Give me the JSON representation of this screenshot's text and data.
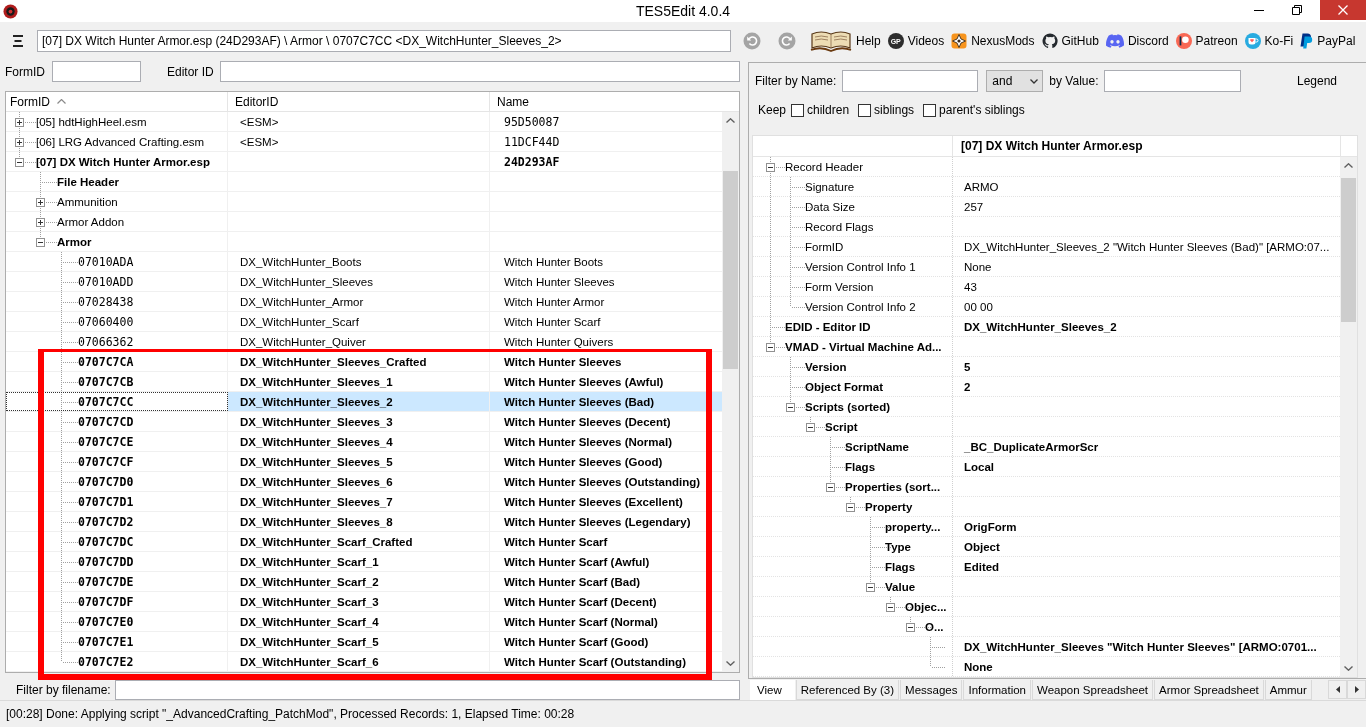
{
  "window": {
    "title": "TES5Edit 4.0.4"
  },
  "toolbar": {
    "path": "[07] DX Witch Hunter Armor.esp (24D293AF) \\ Armor \\ 0707C7CC <DX_WitchHunter_Sleeves_2>",
    "links": [
      {
        "kind": "book",
        "label": "Help"
      },
      {
        "kind": "badge",
        "badge": "GP",
        "label": "Videos"
      },
      {
        "kind": "nexus",
        "label": "NexusMods"
      },
      {
        "kind": "github",
        "label": "GitHub"
      },
      {
        "kind": "discord",
        "label": "Discord"
      },
      {
        "kind": "patreon",
        "label": "Patreon"
      },
      {
        "kind": "kofi",
        "label": "Ko-Fi"
      },
      {
        "kind": "paypal",
        "label": "PayPal"
      }
    ]
  },
  "search": {
    "form_id_label": "FormID",
    "editor_id_label": "Editor ID"
  },
  "tree": {
    "columns": [
      {
        "label": "FormID",
        "sorted": true
      },
      {
        "label": "EditorID",
        "sorted": false
      },
      {
        "label": "Name",
        "sorted": false
      }
    ],
    "nodes": [
      {
        "label": "[05] hdtHighHeel.esm",
        "editor_id": "<ESM>",
        "name": "95D50087",
        "expanded": false,
        "modified": false,
        "selected": false
      },
      {
        "label": "[06] LRG Advanced Crafting.esm",
        "editor_id": "<ESM>",
        "name": "11DCF44D",
        "expanded": false,
        "modified": false,
        "selected": false
      },
      {
        "label": "[07] DX Witch Hunter Armor.esp",
        "name": "24D293AF",
        "expanded": true,
        "modified": true,
        "selected": false,
        "children": [
          {
            "label": "File Header",
            "modified": true,
            "selected": false
          },
          {
            "label": "Ammunition",
            "expanded": false,
            "modified": false,
            "selected": false
          },
          {
            "label": "Armor Addon",
            "expanded": false,
            "modified": false,
            "selected": false
          },
          {
            "label": "Armor",
            "expanded": true,
            "modified": true,
            "selected": false,
            "children": [
              {
                "form_id": "07010ADA",
                "editor_id": "DX_WitchHunter_Boots",
                "name": "Witch Hunter Boots",
                "modified": false,
                "selected": false
              },
              {
                "form_id": "07010ADD",
                "editor_id": "DX_WitchHunter_Sleeves",
                "name": "Witch Hunter Sleeves",
                "modified": false,
                "selected": false
              },
              {
                "form_id": "07028438",
                "editor_id": "DX_WitchHunter_Armor",
                "name": "Witch Hunter Armor",
                "modified": false,
                "selected": false
              },
              {
                "form_id": "07060400",
                "editor_id": "DX_WitchHunter_Scarf",
                "name": "Witch Hunter Scarf",
                "modified": false,
                "selected": false
              },
              {
                "form_id": "07066362",
                "editor_id": "DX_WitchHunter_Quiver",
                "name": "Witch Hunter Quivers",
                "modified": false,
                "selected": false
              },
              {
                "form_id": "0707C7CA",
                "editor_id": "DX_WitchHunter_Sleeves_Crafted",
                "name": "Witch Hunter Sleeves",
                "modified": true,
                "selected": false
              },
              {
                "form_id": "0707C7CB",
                "editor_id": "DX_WitchHunter_Sleeves_1",
                "name": "Witch Hunter Sleeves (Awful)",
                "modified": true,
                "selected": false
              },
              {
                "form_id": "0707C7CC",
                "editor_id": "DX_WitchHunter_Sleeves_2",
                "name": "Witch Hunter Sleeves (Bad)",
                "modified": true,
                "selected": true
              },
              {
                "form_id": "0707C7CD",
                "editor_id": "DX_WitchHunter_Sleeves_3",
                "name": "Witch Hunter Sleeves (Decent)",
                "modified": true,
                "selected": false
              },
              {
                "form_id": "0707C7CE",
                "editor_id": "DX_WitchHunter_Sleeves_4",
                "name": "Witch Hunter Sleeves (Normal)",
                "modified": true,
                "selected": false
              },
              {
                "form_id": "0707C7CF",
                "editor_id": "DX_WitchHunter_Sleeves_5",
                "name": "Witch Hunter Sleeves (Good)",
                "modified": true,
                "selected": false
              },
              {
                "form_id": "0707C7D0",
                "editor_id": "DX_WitchHunter_Sleeves_6",
                "name": "Witch Hunter Sleeves (Outstanding)",
                "modified": true,
                "selected": false
              },
              {
                "form_id": "0707C7D1",
                "editor_id": "DX_WitchHunter_Sleeves_7",
                "name": "Witch Hunter Sleeves (Excellent)",
                "modified": true,
                "selected": false
              },
              {
                "form_id": "0707C7D2",
                "editor_id": "DX_WitchHunter_Sleeves_8",
                "name": "Witch Hunter Sleeves (Legendary)",
                "modified": true,
                "selected": false
              },
              {
                "form_id": "0707C7DC",
                "editor_id": "DX_WitchHunter_Scarf_Crafted",
                "name": "Witch Hunter Scarf",
                "modified": true,
                "selected": false
              },
              {
                "form_id": "0707C7DD",
                "editor_id": "DX_WitchHunter_Scarf_1",
                "name": "Witch Hunter Scarf (Awful)",
                "modified": true,
                "selected": false
              },
              {
                "form_id": "0707C7DE",
                "editor_id": "DX_WitchHunter_Scarf_2",
                "name": "Witch Hunter Scarf (Bad)",
                "modified": true,
                "selected": false
              },
              {
                "form_id": "0707C7DF",
                "editor_id": "DX_WitchHunter_Scarf_3",
                "name": "Witch Hunter Scarf (Decent)",
                "modified": true,
                "selected": false
              },
              {
                "form_id": "0707C7E0",
                "editor_id": "DX_WitchHunter_Scarf_4",
                "name": "Witch Hunter Scarf (Normal)",
                "modified": true,
                "selected": false
              },
              {
                "form_id": "0707C7E1",
                "editor_id": "DX_WitchHunter_Scarf_5",
                "name": "Witch Hunter Scarf (Good)",
                "modified": true,
                "selected": false
              },
              {
                "form_id": "0707C7E2",
                "editor_id": "DX_WitchHunter_Scarf_6",
                "name": "Witch Hunter Scarf (Outstanding)",
                "modified": true,
                "selected": false
              }
            ]
          }
        ]
      }
    ]
  },
  "file_filter": {
    "label": "Filter by filename:"
  },
  "record_filter": {
    "name_label": "Filter by Name:",
    "operator": "and",
    "value_label": "by Value:",
    "legend": "Legend",
    "keep_label": "Keep",
    "keep_options": [
      {
        "label": "children",
        "checked": false
      },
      {
        "label": "siblings",
        "checked": false
      },
      {
        "label": "parent's siblings",
        "checked": false
      }
    ]
  },
  "record_view": {
    "title": "[07] DX Witch Hunter Armor.esp",
    "rows": [
      {
        "label": "Record Header",
        "expanded": true,
        "modified": false,
        "children": [
          {
            "label": "Signature",
            "value": "ARMO",
            "modified": false
          },
          {
            "label": "Data Size",
            "value": "257",
            "modified": false
          },
          {
            "label": "Record Flags",
            "modified": false
          },
          {
            "label": "FormID",
            "value": "DX_WitchHunter_Sleeves_2 \"Witch Hunter Sleeves (Bad)\" [ARMO:07...",
            "modified": false
          },
          {
            "label": "Version Control Info 1",
            "value": "None",
            "modified": false
          },
          {
            "label": "Form Version",
            "value": "43",
            "modified": false
          },
          {
            "label": "Version Control Info 2",
            "value": "00 00",
            "modified": false
          }
        ]
      },
      {
        "label": "EDID - Editor ID",
        "value": "DX_WitchHunter_Sleeves_2",
        "modified": true
      },
      {
        "label": "VMAD - Virtual Machine Ad...",
        "expanded": true,
        "modified": true,
        "children": [
          {
            "label": "Version",
            "value": "5",
            "modified": true
          },
          {
            "label": "Object Format",
            "value": "2",
            "modified": true
          },
          {
            "label": "Scripts (sorted)",
            "expanded": true,
            "modified": true,
            "children": [
              {
                "label": "Script",
                "expanded": true,
                "modified": true,
                "children": [
                  {
                    "label": "ScriptName",
                    "value": "_BC_DuplicateArmorScr",
                    "modified": true
                  },
                  {
                    "label": "Flags",
                    "value": "Local",
                    "modified": true
                  },
                  {
                    "label": "Properties (sort...",
                    "expanded": true,
                    "modified": true,
                    "children": [
                      {
                        "label": "Property",
                        "expanded": true,
                        "modified": true,
                        "children": [
                          {
                            "label": "property...",
                            "value": "OrigForm",
                            "modified": true
                          },
                          {
                            "label": "Type",
                            "value": "Object",
                            "modified": true
                          },
                          {
                            "label": "Flags",
                            "value": "Edited",
                            "modified": true
                          },
                          {
                            "label": "Value",
                            "expanded": true,
                            "modified": true,
                            "children": [
                              {
                                "label": "Objec...",
                                "expanded": true,
                                "modified": true,
                                "children": [
                                  {
                                    "label": "O...",
                                    "expanded": true,
                                    "modified": true,
                                    "children": [
                                      {
                                        "value": "DX_WitchHunter_Sleeves \"Witch Hunter Sleeves\" [ARMO:0701...",
                                        "modified": true
                                      },
                                      {
                                        "value": "None",
                                        "modified": true
                                      }
                                    ]
                                  }
                                ]
                              }
                            ]
                          }
                        ]
                      }
                    ]
                  }
                ]
              }
            ]
          }
        ]
      }
    ]
  },
  "tabs": [
    {
      "label": "View",
      "selected": true
    },
    {
      "label": "Referenced By (3)",
      "selected": false
    },
    {
      "label": "Messages",
      "selected": false
    },
    {
      "label": "Information",
      "selected": false
    },
    {
      "label": "Weapon Spreadsheet",
      "selected": false
    },
    {
      "label": "Armor Spreadsheet",
      "selected": false
    },
    {
      "label": "Ammur",
      "selected": false
    }
  ],
  "status_bar": {
    "text": "[00:28] Done: Applying script \"_AdvancedCrafting_PatchMod\", Processed Records: 1, Elapsed Time: 00:28"
  }
}
